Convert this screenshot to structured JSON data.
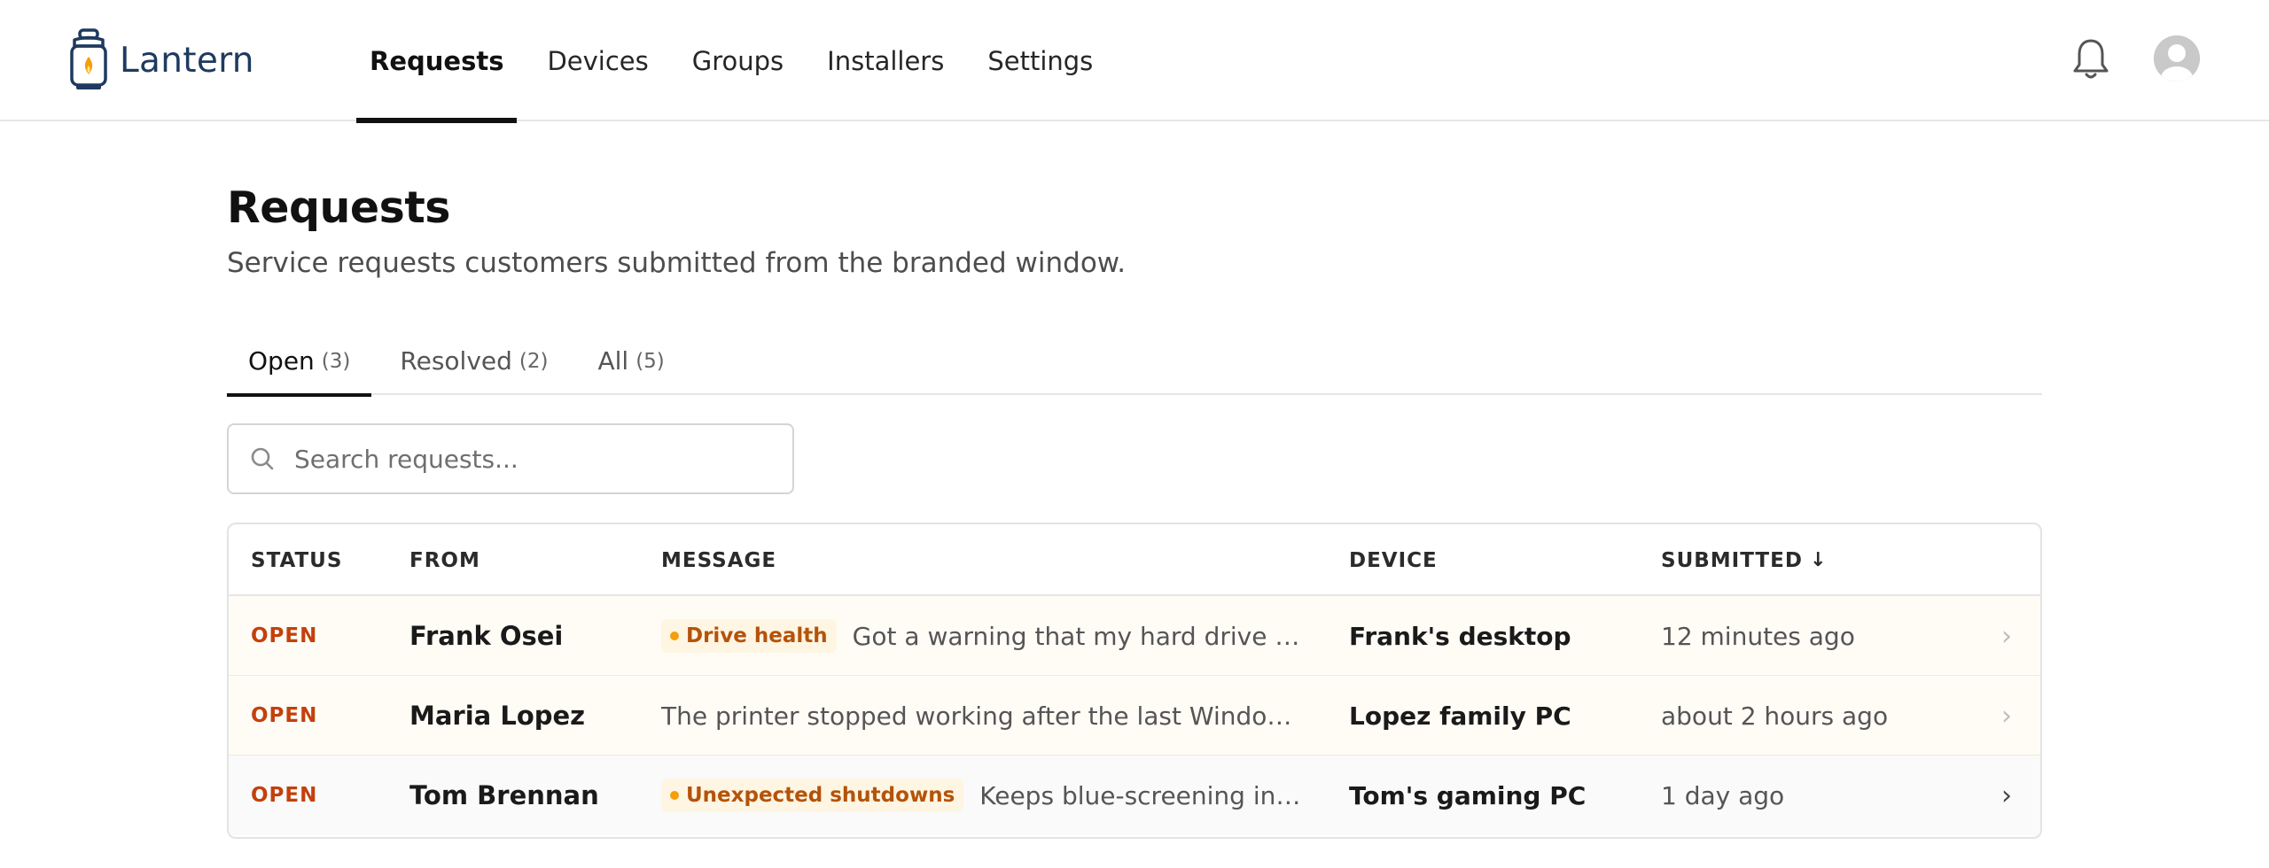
{
  "app": {
    "name": "Lantern"
  },
  "nav": {
    "items": [
      {
        "label": "Requests",
        "active": true
      },
      {
        "label": "Devices",
        "active": false
      },
      {
        "label": "Groups",
        "active": false
      },
      {
        "label": "Installers",
        "active": false
      },
      {
        "label": "Settings",
        "active": false
      }
    ]
  },
  "header_icons": [
    "bell-icon",
    "avatar"
  ],
  "page": {
    "title": "Requests",
    "subtitle": "Service requests customers submitted from the branded window."
  },
  "tabs": [
    {
      "label": "Open",
      "count": "(3)",
      "active": true
    },
    {
      "label": "Resolved",
      "count": "(2)",
      "active": false
    },
    {
      "label": "All",
      "count": "(5)",
      "active": false
    }
  ],
  "search": {
    "placeholder": "Search requests...",
    "value": ""
  },
  "table": {
    "columns": [
      "STATUS",
      "FROM",
      "MESSAGE",
      "DEVICE",
      "SUBMITTED"
    ],
    "sort_indicator": "↓",
    "rows": [
      {
        "status": "OPEN",
        "from": "Frank Osei",
        "tag": "Drive health",
        "message": "Got a warning that my hard drive mig...",
        "device": "Frank's desktop",
        "submitted": "12 minutes ago"
      },
      {
        "status": "OPEN",
        "from": "Maria Lopez",
        "tag": "",
        "message": "The printer stopped working after the last Windows ...",
        "device": "Lopez family PC",
        "submitted": "about 2 hours ago"
      },
      {
        "status": "OPEN",
        "from": "Tom Brennan",
        "tag": "Unexpected shutdowns",
        "message": "Keeps blue-screening in th...",
        "device": "Tom's gaming PC",
        "submitted": "1 day ago"
      }
    ]
  },
  "colors": {
    "status_open": "#c2410c",
    "tag_bg": "#fff5e3",
    "tag_text": "#b45309",
    "tag_dot": "#f59e0b",
    "brand": "#1e3a5f",
    "flame": "#f59e0b"
  }
}
